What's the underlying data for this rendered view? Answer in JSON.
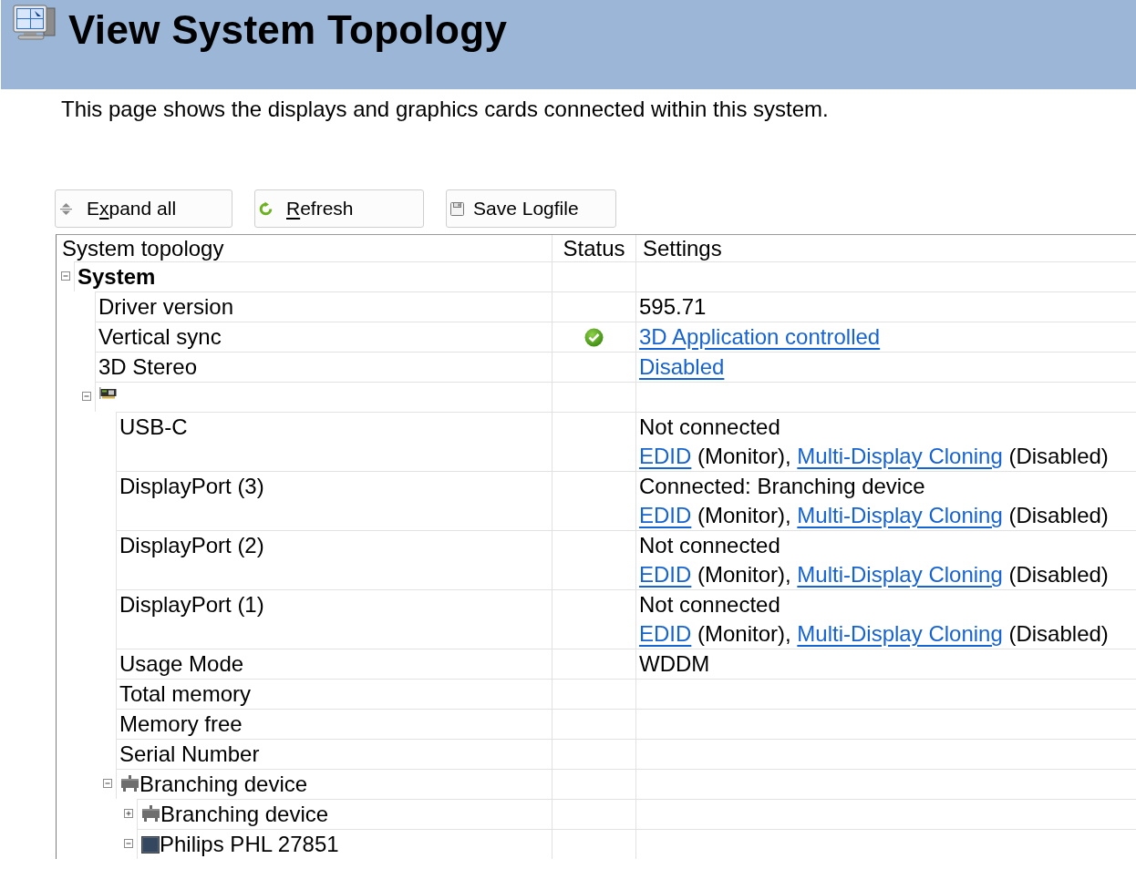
{
  "header": {
    "title": "View System Topology"
  },
  "description": "This page shows the displays and graphics cards connected within this system.",
  "toolbar": {
    "buttons": [
      {
        "kind": "expand",
        "label": [
          {
            "text": "E",
            "underlined": false
          },
          {
            "text": "x",
            "underlined": true
          },
          {
            "text": "pand all",
            "underlined": false
          }
        ]
      },
      {
        "kind": "refresh",
        "label": [
          {
            "text": "R",
            "underlined": true
          },
          {
            "text": "efresh",
            "underlined": false
          }
        ]
      },
      {
        "kind": "save",
        "label": [
          {
            "text": "Save Logfile",
            "underlined": false
          }
        ]
      }
    ]
  },
  "table": {
    "columns": [
      "System topology",
      "Status",
      "Settings"
    ],
    "rows": [
      {
        "kind": "group",
        "label": "System",
        "expanded": true,
        "children": [
          {
            "kind": "property",
            "label": "Driver version",
            "status_ok": false,
            "settings": [
              [
                {
                  "text": "595.71",
                  "link": false
                }
              ]
            ]
          },
          {
            "kind": "property",
            "label": "Vertical sync",
            "status_ok": true,
            "settings": [
              [
                {
                  "text": "3D Application controlled",
                  "link": true
                }
              ]
            ]
          },
          {
            "kind": "property",
            "label": "3D Stereo",
            "status_ok": false,
            "settings": [
              [
                {
                  "text": "Disabled",
                  "link": true
                }
              ]
            ]
          },
          {
            "kind": "graphics_card",
            "expanded": true,
            "children": [
              {
                "kind": "property",
                "label": "USB-C",
                "status_ok": false,
                "settings": [
                  [
                    {
                      "text": "Not connected",
                      "link": false
                    }
                  ],
                  [
                    {
                      "text": "EDID",
                      "link": true
                    },
                    {
                      "text": " (Monitor), ",
                      "link": false
                    },
                    {
                      "text": "Multi-Display Cloning",
                      "link": true
                    },
                    {
                      "text": " (Disabled)",
                      "link": false
                    }
                  ]
                ]
              },
              {
                "kind": "property",
                "label": "DisplayPort (3)",
                "status_ok": false,
                "settings": [
                  [
                    {
                      "text": "Connected: Branching device",
                      "link": false
                    }
                  ],
                  [
                    {
                      "text": "EDID",
                      "link": true
                    },
                    {
                      "text": " (Monitor), ",
                      "link": false
                    },
                    {
                      "text": "Multi-Display Cloning",
                      "link": true
                    },
                    {
                      "text": " (Disabled)",
                      "link": false
                    }
                  ]
                ]
              },
              {
                "kind": "property",
                "label": "DisplayPort (2)",
                "status_ok": false,
                "settings": [
                  [
                    {
                      "text": "Not connected",
                      "link": false
                    }
                  ],
                  [
                    {
                      "text": "EDID",
                      "link": true
                    },
                    {
                      "text": " (Monitor), ",
                      "link": false
                    },
                    {
                      "text": "Multi-Display Cloning",
                      "link": true
                    },
                    {
                      "text": " (Disabled)",
                      "link": false
                    }
                  ]
                ]
              },
              {
                "kind": "property",
                "label": "DisplayPort (1)",
                "status_ok": false,
                "settings": [
                  [
                    {
                      "text": "Not connected",
                      "link": false
                    }
                  ],
                  [
                    {
                      "text": "EDID",
                      "link": true
                    },
                    {
                      "text": " (Monitor), ",
                      "link": false
                    },
                    {
                      "text": "Multi-Display Cloning",
                      "link": true
                    },
                    {
                      "text": " (Disabled)",
                      "link": false
                    }
                  ]
                ]
              },
              {
                "kind": "property",
                "label": "Usage Mode",
                "status_ok": false,
                "settings": [
                  [
                    {
                      "text": "WDDM",
                      "link": false
                    }
                  ]
                ]
              },
              {
                "kind": "property",
                "label": "Total memory",
                "status_ok": false
              },
              {
                "kind": "property",
                "label": "Memory free",
                "status_ok": false
              },
              {
                "kind": "property",
                "label": "Serial Number",
                "status_ok": false
              },
              {
                "kind": "branching_device",
                "label": "Branching device",
                "expanded": true,
                "children": [
                  {
                    "kind": "branching_device",
                    "label": "Branching device",
                    "expanded": false
                  },
                  {
                    "kind": "display",
                    "label": "Philips PHL 27851",
                    "expanded": true
                  }
                ]
              }
            ]
          }
        ]
      }
    ]
  }
}
